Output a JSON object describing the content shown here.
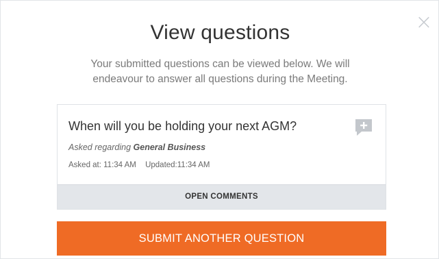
{
  "modal": {
    "close_label": "×",
    "title": "View questions",
    "subtitle": "Your submitted questions can be viewed below. We will endeavour to answer all questions during the Meeting."
  },
  "question": {
    "text": "When will you be holding your next AGM?",
    "asked_regarding_prefix": "Asked regarding",
    "topic": "General Business",
    "asked_at": "Asked at: 11:34 AM",
    "updated": "Updated:11:34 AM",
    "open_comments_label": "OPEN COMMENTS",
    "comment_icon": "add-comment-icon"
  },
  "actions": {
    "submit_another_label": "SUBMIT ANOTHER QUESTION"
  },
  "colors": {
    "accent": "#ef6b25",
    "comments_bar": "#e3e6ea",
    "icon_gray": "#c3c7cc"
  }
}
